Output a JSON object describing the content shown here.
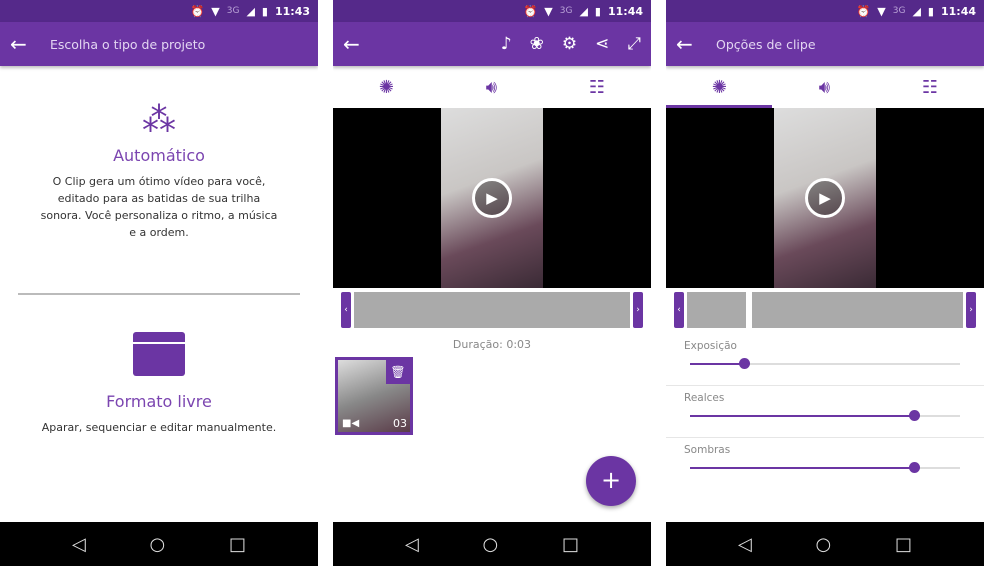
{
  "screens": [
    {
      "time": "11:43",
      "network": "3G",
      "title": "Escolha o tipo de projeto",
      "options": [
        {
          "title": "Automático",
          "description": "O Clip gera um ótimo vídeo para você, editado para as batidas de sua trilha sonora. Você personaliza o ritmo, a música e a ordem."
        },
        {
          "title": "Formato livre",
          "description": "Aparar, sequenciar e editar manualmente."
        }
      ]
    },
    {
      "time": "11:44",
      "network": "3G",
      "duration": "Duração: 0:03",
      "clip_time": "03",
      "fab": "+"
    },
    {
      "time": "11:44",
      "network": "3G",
      "title": "Opções de clipe",
      "sliders": [
        {
          "label": "Exposição",
          "value": 0.2
        },
        {
          "label": "Realces",
          "value": 0.83
        },
        {
          "label": "Sombras",
          "value": 0.83
        }
      ]
    }
  ],
  "accent": "#6b35a3"
}
